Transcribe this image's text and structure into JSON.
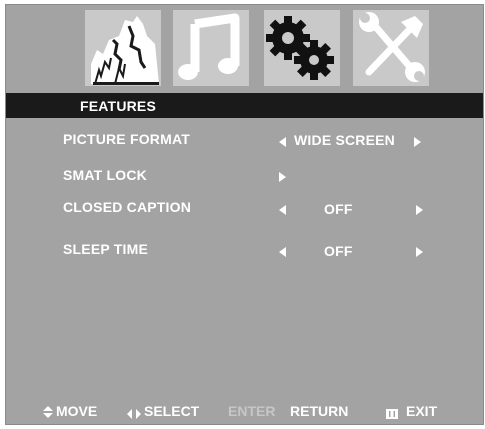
{
  "tabs": [
    {
      "name": "picture",
      "icon": "picture-icon"
    },
    {
      "name": "music",
      "icon": "music-note-icon"
    },
    {
      "name": "features",
      "icon": "gear-icon",
      "selected": true
    },
    {
      "name": "setup",
      "icon": "tools-icon"
    }
  ],
  "header": {
    "title": "FEATURES"
  },
  "menu": {
    "picture_format": {
      "label": "PICTURE FORMAT",
      "value": "WIDE SCREEN"
    },
    "smat_lock": {
      "label": "SMAT LOCK"
    },
    "closed_caption": {
      "label": "CLOSED CAPTION",
      "value": "OFF"
    },
    "sleep_time": {
      "label": "SLEEP TIME",
      "value": "OFF"
    }
  },
  "footer": {
    "move": "MOVE",
    "select": "SELECT",
    "enter": "ENTER",
    "return": "RETURN",
    "exit": "EXIT"
  },
  "colors": {
    "panel": "#a3a3a3",
    "header": "#1a1a1a",
    "tab_bg": "#c9c9c9",
    "text": "#ffffff"
  }
}
